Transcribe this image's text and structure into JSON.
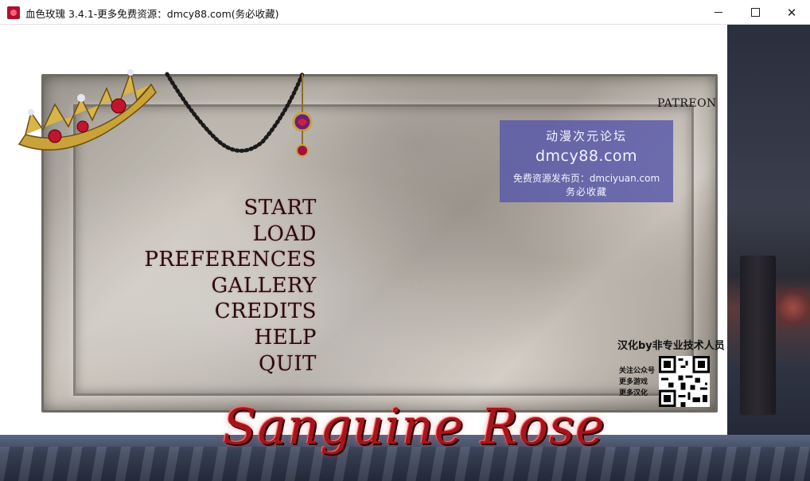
{
  "window": {
    "title": "血色玫瑰 3.4.1-更多免费资源：dmcy88.com(务必收藏)",
    "minimize_symbol": "—",
    "maximize_symbol": "☐",
    "close_symbol": "✕"
  },
  "menu": {
    "items": [
      "START",
      "LOAD",
      "PREFERENCES",
      "GALLERY",
      "CREDITS",
      "HELP",
      "QUIT"
    ]
  },
  "patreon": "PATREON",
  "watermark": {
    "line1": "动漫次元论坛",
    "line2": "dmcy88.com",
    "line3": "免费资源发布页：dmciyuan.com",
    "line4": "务必收藏"
  },
  "translation_credit": {
    "title": "汉化by非专业技术人员",
    "lines": [
      "关注公众号",
      "更多游戏",
      "更多汉化"
    ]
  },
  "game_title": "Sanguine Rose",
  "colors": {
    "title_red": "#a8141c",
    "menu_text": "#2a0a0c",
    "watermark_bg": "#5858aa"
  }
}
